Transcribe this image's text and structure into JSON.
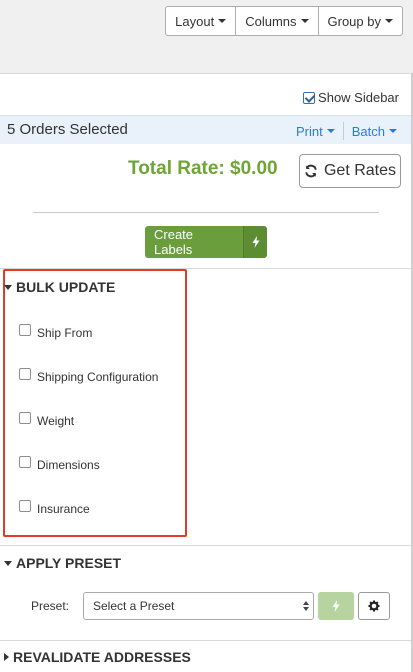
{
  "toolbar": {
    "layout_label": "Layout",
    "columns_label": "Columns",
    "groupby_label": "Group by"
  },
  "sidebar_toggle": {
    "label": "Show Sidebar",
    "checked": true
  },
  "selection": {
    "count_text": "5 Orders Selected",
    "print_label": "Print",
    "batch_label": "Batch"
  },
  "rates": {
    "total_text": "Total Rate: $0.00",
    "get_rates_label": "Get Rates"
  },
  "create_labels": {
    "label": "Create Labels"
  },
  "bulk_update": {
    "title": "BULK UPDATE",
    "options": [
      {
        "label": "Ship From",
        "checked": false
      },
      {
        "label": "Shipping Configuration",
        "checked": false
      },
      {
        "label": "Weight",
        "checked": false
      },
      {
        "label": "Dimensions",
        "checked": false
      },
      {
        "label": "Insurance",
        "checked": false
      }
    ]
  },
  "apply_preset": {
    "title": "APPLY PRESET",
    "preset_label": "Preset:",
    "select_value": "Select a Preset"
  },
  "revalidate": {
    "title": "REVALIDATE ADDRESSES"
  },
  "colors": {
    "accent_green": "#6a9d3b",
    "total_green": "#6ea534",
    "link_blue": "#2a7bd5",
    "highlight_red": "#e43a2a",
    "selection_bg": "#e9f2fb"
  },
  "icons": {
    "refresh": "refresh-icon",
    "bolt": "bolt-icon",
    "gear": "gear-icon",
    "caret": "caret-down-icon"
  }
}
